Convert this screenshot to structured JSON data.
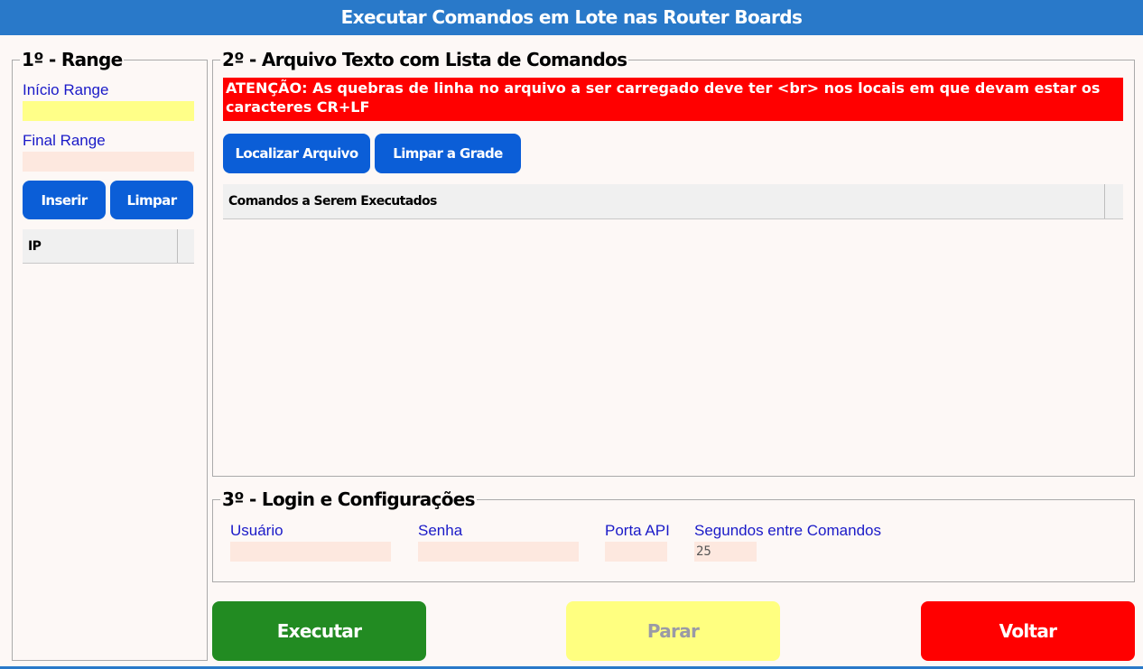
{
  "window": {
    "title": "Executar Comandos em Lote nas Router Boards"
  },
  "range": {
    "legend": "1º - Range",
    "inicio_label": "Início Range",
    "inicio_value": "",
    "final_label": "Final Range",
    "final_value": "",
    "inserir_label": "Inserir",
    "limpar_label": "Limpar",
    "grid": {
      "columns": [
        "IP"
      ],
      "rows": []
    }
  },
  "arquivo": {
    "legend": "2º - Arquivo Texto com Lista de Comandos",
    "warning": "ATENÇÃO: As quebras de linha no arquivo a ser carregado deve ter <br> nos locais em que devam estar os caracteres CR+LF",
    "localizar_label": "Localizar Arquivo",
    "limpar_grade_label": "Limpar a Grade",
    "grid": {
      "columns": [
        "Comandos a Serem Executados"
      ],
      "rows": []
    }
  },
  "login": {
    "legend": "3º - Login e Configurações",
    "usuario_label": "Usuário",
    "usuario_value": "",
    "senha_label": "Senha",
    "senha_value": "",
    "porta_label": "Porta API",
    "porta_value": "",
    "segundos_label": "Segundos entre Comandos",
    "segundos_value": "25"
  },
  "actions": {
    "executar_label": "Executar",
    "parar_label": "Parar",
    "voltar_label": "Voltar"
  },
  "colors": {
    "title_bar": "#2979c9",
    "button_blue": "#0b5ed7",
    "executar": "#228b22",
    "parar": "#ffff80",
    "voltar": "#ff0000",
    "warning": "#ff0000",
    "label_blue": "#1a1ac8"
  }
}
